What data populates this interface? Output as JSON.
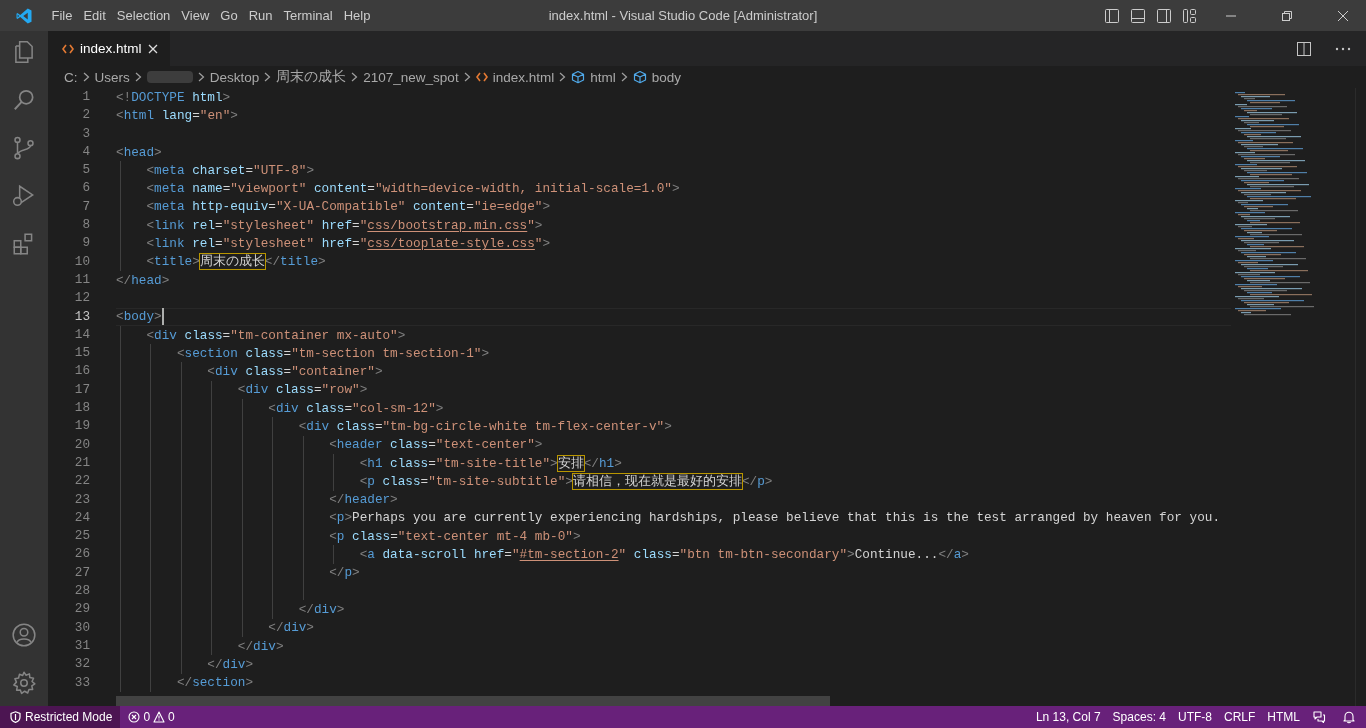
{
  "window": {
    "title": "index.html - Visual Studio Code [Administrator]"
  },
  "menu": [
    "File",
    "Edit",
    "Selection",
    "View",
    "Go",
    "Run",
    "Terminal",
    "Help"
  ],
  "tabs": [
    {
      "label": "index.html",
      "selected": true
    }
  ],
  "breadcrumbs": [
    {
      "kind": "folder",
      "label": "C:"
    },
    {
      "kind": "folder",
      "label": "Users"
    },
    {
      "kind": "redacted"
    },
    {
      "kind": "folder",
      "label": "Desktop"
    },
    {
      "kind": "folder",
      "label": "周末の成长"
    },
    {
      "kind": "folder",
      "label": "2107_new_spot"
    },
    {
      "kind": "file",
      "label": "index.html"
    },
    {
      "kind": "element",
      "label": "html"
    },
    {
      "kind": "element",
      "label": "body"
    }
  ],
  "editor": {
    "lines": [
      {
        "number": "1",
        "current": false,
        "tokens": [
          {
            "kind": "p",
            "text": "<!"
          },
          {
            "kind": "tag",
            "text": "DOCTYPE"
          },
          {
            "kind": "attr",
            "text": " html"
          },
          {
            "kind": "p",
            "text": ">"
          }
        ]
      },
      {
        "number": "2",
        "current": false,
        "tokens": [
          {
            "kind": "p",
            "text": "<"
          },
          {
            "kind": "tag",
            "text": "html"
          },
          {
            "kind": "attr",
            "text": " lang"
          },
          {
            "kind": "text",
            "text": "="
          },
          {
            "kind": "str",
            "text": "\"en\""
          },
          {
            "kind": "p",
            "text": ">"
          }
        ]
      },
      {
        "number": "3",
        "current": false
      },
      {
        "number": "4",
        "current": false,
        "tokens": [
          {
            "kind": "p",
            "text": "<"
          },
          {
            "kind": "tag",
            "text": "head"
          },
          {
            "kind": "p",
            "text": ">"
          }
        ]
      },
      {
        "number": "5",
        "current": false,
        "tokens": [
          {
            "kind": "p",
            "text": "    <"
          },
          {
            "kind": "tag",
            "text": "meta"
          },
          {
            "kind": "attr",
            "text": " charset"
          },
          {
            "kind": "text",
            "text": "="
          },
          {
            "kind": "str",
            "text": "\"UTF-8\""
          },
          {
            "kind": "p",
            "text": ">"
          }
        ]
      },
      {
        "number": "6",
        "current": false,
        "tokens": [
          {
            "kind": "p",
            "text": "    <"
          },
          {
            "kind": "tag",
            "text": "meta"
          },
          {
            "kind": "attr",
            "text": " name"
          },
          {
            "kind": "text",
            "text": "="
          },
          {
            "kind": "str",
            "text": "\"viewport\""
          },
          {
            "kind": "attr",
            "text": " content"
          },
          {
            "kind": "text",
            "text": "="
          },
          {
            "kind": "str",
            "text": "\"width=device-width, initial-scale=1.0\""
          },
          {
            "kind": "p",
            "text": ">"
          }
        ]
      },
      {
        "number": "7",
        "current": false,
        "tokens": [
          {
            "kind": "p",
            "text": "    <"
          },
          {
            "kind": "tag",
            "text": "meta"
          },
          {
            "kind": "attr",
            "text": " http-equiv"
          },
          {
            "kind": "text",
            "text": "="
          },
          {
            "kind": "str",
            "text": "\"X-UA-Compatible\""
          },
          {
            "kind": "attr",
            "text": " content"
          },
          {
            "kind": "text",
            "text": "="
          },
          {
            "kind": "str",
            "text": "\"ie=edge\""
          },
          {
            "kind": "p",
            "text": ">"
          }
        ]
      },
      {
        "number": "8",
        "current": false,
        "tokens": [
          {
            "kind": "p",
            "text": "    <"
          },
          {
            "kind": "tag",
            "text": "link"
          },
          {
            "kind": "attr",
            "text": " rel"
          },
          {
            "kind": "text",
            "text": "="
          },
          {
            "kind": "str",
            "text": "\"stylesheet\""
          },
          {
            "kind": "attr",
            "text": " href"
          },
          {
            "kind": "text",
            "text": "="
          },
          {
            "kind": "str",
            "text": "\""
          },
          {
            "kind": "link",
            "text": "css/bootstrap.min.css"
          },
          {
            "kind": "str",
            "text": "\""
          },
          {
            "kind": "p",
            "text": ">"
          }
        ]
      },
      {
        "number": "9",
        "current": false,
        "tokens": [
          {
            "kind": "p",
            "text": "    <"
          },
          {
            "kind": "tag",
            "text": "link"
          },
          {
            "kind": "attr",
            "text": " rel"
          },
          {
            "kind": "text",
            "text": "="
          },
          {
            "kind": "str",
            "text": "\"stylesheet\""
          },
          {
            "kind": "attr",
            "text": " href"
          },
          {
            "kind": "text",
            "text": "="
          },
          {
            "kind": "str",
            "text": "\""
          },
          {
            "kind": "link",
            "text": "css/tooplate-style.css"
          },
          {
            "kind": "str",
            "text": "\""
          },
          {
            "kind": "p",
            "text": ">"
          }
        ]
      },
      {
        "number": "10",
        "current": false,
        "tokens": [
          {
            "kind": "p",
            "text": "    <"
          },
          {
            "kind": "tag",
            "text": "title"
          },
          {
            "kind": "p",
            "text": ">"
          },
          {
            "kind": "hl",
            "text": "周末の成长"
          },
          {
            "kind": "p",
            "text": "</"
          },
          {
            "kind": "tag",
            "text": "title"
          },
          {
            "kind": "p",
            "text": ">"
          }
        ]
      },
      {
        "number": "11",
        "current": false,
        "tokens": [
          {
            "kind": "p",
            "text": "</"
          },
          {
            "kind": "tag",
            "text": "head"
          },
          {
            "kind": "p",
            "text": ">"
          }
        ]
      },
      {
        "number": "12",
        "current": false
      },
      {
        "number": "13",
        "current": true,
        "tokens": [
          {
            "kind": "p",
            "text": "<"
          },
          {
            "kind": "tag",
            "text": "body"
          },
          {
            "kind": "p",
            "text": ">"
          }
        ]
      },
      {
        "number": "14",
        "current": false,
        "tokens": [
          {
            "kind": "p",
            "text": "    <"
          },
          {
            "kind": "tag",
            "text": "div"
          },
          {
            "kind": "attr",
            "text": " class"
          },
          {
            "kind": "text",
            "text": "="
          },
          {
            "kind": "str",
            "text": "\"tm-container mx-auto\""
          },
          {
            "kind": "p",
            "text": ">"
          }
        ]
      },
      {
        "number": "15",
        "current": false,
        "tokens": [
          {
            "kind": "p",
            "text": "        <"
          },
          {
            "kind": "tag",
            "text": "section"
          },
          {
            "kind": "attr",
            "text": " class"
          },
          {
            "kind": "text",
            "text": "="
          },
          {
            "kind": "str",
            "text": "\"tm-section tm-section-1\""
          },
          {
            "kind": "p",
            "text": ">"
          }
        ]
      },
      {
        "number": "16",
        "current": false,
        "tokens": [
          {
            "kind": "p",
            "text": "            <"
          },
          {
            "kind": "tag",
            "text": "div"
          },
          {
            "kind": "attr",
            "text": " class"
          },
          {
            "kind": "text",
            "text": "="
          },
          {
            "kind": "str",
            "text": "\"container\""
          },
          {
            "kind": "p",
            "text": ">"
          }
        ]
      },
      {
        "number": "17",
        "current": false,
        "tokens": [
          {
            "kind": "p",
            "text": "                <"
          },
          {
            "kind": "tag",
            "text": "div"
          },
          {
            "kind": "attr",
            "text": " class"
          },
          {
            "kind": "text",
            "text": "="
          },
          {
            "kind": "str",
            "text": "\"row\""
          },
          {
            "kind": "p",
            "text": ">"
          }
        ]
      },
      {
        "number": "18",
        "current": false,
        "tokens": [
          {
            "kind": "p",
            "text": "                    <"
          },
          {
            "kind": "tag",
            "text": "div"
          },
          {
            "kind": "attr",
            "text": " class"
          },
          {
            "kind": "text",
            "text": "="
          },
          {
            "kind": "str",
            "text": "\"col-sm-12\""
          },
          {
            "kind": "p",
            "text": ">"
          }
        ]
      },
      {
        "number": "19",
        "current": false,
        "tokens": [
          {
            "kind": "p",
            "text": "                        <"
          },
          {
            "kind": "tag",
            "text": "div"
          },
          {
            "kind": "attr",
            "text": " class"
          },
          {
            "kind": "text",
            "text": "="
          },
          {
            "kind": "str",
            "text": "\"tm-bg-circle-white tm-flex-center-v\""
          },
          {
            "kind": "p",
            "text": ">"
          }
        ]
      },
      {
        "number": "20",
        "current": false,
        "tokens": [
          {
            "kind": "p",
            "text": "                            <"
          },
          {
            "kind": "tag",
            "text": "header"
          },
          {
            "kind": "attr",
            "text": " class"
          },
          {
            "kind": "text",
            "text": "="
          },
          {
            "kind": "str",
            "text": "\"text-center\""
          },
          {
            "kind": "p",
            "text": ">"
          }
        ]
      },
      {
        "number": "21",
        "current": false,
        "tokens": [
          {
            "kind": "p",
            "text": "                                <"
          },
          {
            "kind": "tag",
            "text": "h1"
          },
          {
            "kind": "attr",
            "text": " class"
          },
          {
            "kind": "text",
            "text": "="
          },
          {
            "kind": "str",
            "text": "\"tm-site-title\""
          },
          {
            "kind": "p",
            "text": ">"
          },
          {
            "kind": "hl",
            "text": "安排"
          },
          {
            "kind": "p",
            "text": "</"
          },
          {
            "kind": "tag",
            "text": "h1"
          },
          {
            "kind": "p",
            "text": ">"
          }
        ]
      },
      {
        "number": "22",
        "current": false,
        "tokens": [
          {
            "kind": "p",
            "text": "                                <"
          },
          {
            "kind": "tag",
            "text": "p"
          },
          {
            "kind": "attr",
            "text": " class"
          },
          {
            "kind": "text",
            "text": "="
          },
          {
            "kind": "str",
            "text": "\"tm-site-subtitle\""
          },
          {
            "kind": "p",
            "text": ">"
          },
          {
            "kind": "hl",
            "text": "请相信，现在就是最好的安排"
          },
          {
            "kind": "p",
            "text": "</"
          },
          {
            "kind": "tag",
            "text": "p"
          },
          {
            "kind": "p",
            "text": ">"
          }
        ]
      },
      {
        "number": "23",
        "current": false,
        "tokens": [
          {
            "kind": "p",
            "text": "                            </"
          },
          {
            "kind": "tag",
            "text": "header"
          },
          {
            "kind": "p",
            "text": ">"
          }
        ]
      },
      {
        "number": "24",
        "current": false,
        "tokens": [
          {
            "kind": "p",
            "text": "                            <"
          },
          {
            "kind": "tag",
            "text": "p"
          },
          {
            "kind": "p",
            "text": ">"
          },
          {
            "kind": "text",
            "text": "Perhaps you are currently experiencing hardships, please believe that this is the test arranged by heaven for you."
          }
        ]
      },
      {
        "number": "25",
        "current": false,
        "tokens": [
          {
            "kind": "p",
            "text": "                            <"
          },
          {
            "kind": "tag",
            "text": "p"
          },
          {
            "kind": "attr",
            "text": " class"
          },
          {
            "kind": "text",
            "text": "="
          },
          {
            "kind": "str",
            "text": "\"text-center mt-4 mb-0\""
          },
          {
            "kind": "p",
            "text": ">"
          }
        ]
      },
      {
        "number": "26",
        "current": false,
        "tokens": [
          {
            "kind": "p",
            "text": "                                <"
          },
          {
            "kind": "tag",
            "text": "a"
          },
          {
            "kind": "attr",
            "text": " data-scroll"
          },
          {
            "kind": "attr",
            "text": " href"
          },
          {
            "kind": "text",
            "text": "="
          },
          {
            "kind": "str",
            "text": "\""
          },
          {
            "kind": "link",
            "text": "#tm-section-2"
          },
          {
            "kind": "str",
            "text": "\""
          },
          {
            "kind": "attr",
            "text": " class"
          },
          {
            "kind": "text",
            "text": "="
          },
          {
            "kind": "str",
            "text": "\"btn tm-btn-secondary\""
          },
          {
            "kind": "p",
            "text": ">"
          },
          {
            "kind": "text",
            "text": "Continue..."
          },
          {
            "kind": "p",
            "text": "</"
          },
          {
            "kind": "tag",
            "text": "a"
          },
          {
            "kind": "p",
            "text": ">"
          }
        ]
      },
      {
        "number": "27",
        "current": false,
        "tokens": [
          {
            "kind": "p",
            "text": "                            </"
          },
          {
            "kind": "tag",
            "text": "p"
          },
          {
            "kind": "p",
            "text": ">"
          }
        ]
      },
      {
        "number": "28",
        "current": false
      },
      {
        "number": "29",
        "current": false,
        "tokens": [
          {
            "kind": "p",
            "text": "                        </"
          },
          {
            "kind": "tag",
            "text": "div"
          },
          {
            "kind": "p",
            "text": ">"
          }
        ]
      },
      {
        "number": "30",
        "current": false,
        "tokens": [
          {
            "kind": "p",
            "text": "                    </"
          },
          {
            "kind": "tag",
            "text": "div"
          },
          {
            "kind": "p",
            "text": ">"
          }
        ]
      },
      {
        "number": "31",
        "current": false,
        "tokens": [
          {
            "kind": "p",
            "text": "                </"
          },
          {
            "kind": "tag",
            "text": "div"
          },
          {
            "kind": "p",
            "text": ">"
          }
        ]
      },
      {
        "number": "32",
        "current": false,
        "tokens": [
          {
            "kind": "p",
            "text": "            </"
          },
          {
            "kind": "tag",
            "text": "div"
          },
          {
            "kind": "p",
            "text": ">"
          }
        ]
      },
      {
        "number": "33",
        "current": false,
        "tokens": [
          {
            "kind": "p",
            "text": "        </"
          },
          {
            "kind": "tag",
            "text": "section"
          },
          {
            "kind": "p",
            "text": ">"
          }
        ]
      }
    ]
  },
  "status_bar": {
    "mode": "Restricted Mode",
    "errors": "0",
    "warnings": "0",
    "items": [
      "Ln 13, Col 7",
      "Spaces: 4",
      "UTF-8",
      "CRLF",
      "HTML"
    ]
  }
}
